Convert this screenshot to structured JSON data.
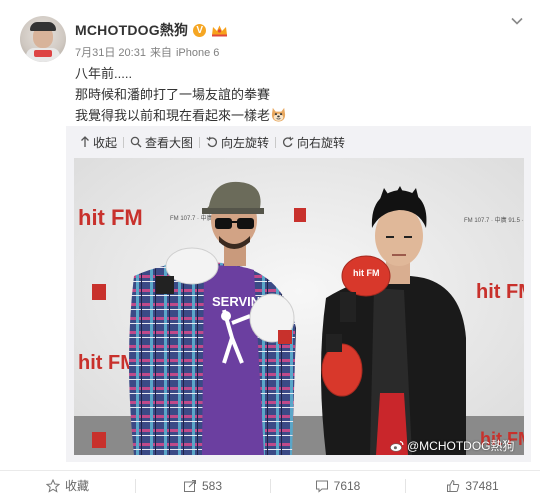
{
  "post": {
    "username": "MCHOTDOG熱狗",
    "verified_badge": "V",
    "time": "7月31日 20:31",
    "source_prefix": "来自",
    "source_device": "iPhone 6",
    "lines": [
      "八年前.....",
      "那時候和潘帥打了一場友誼的拳賽",
      "我覺得我以前和現在看起來一樣老"
    ],
    "emoji_icon": "doge-emoji-icon"
  },
  "toolbar": {
    "collapse": "收起",
    "view_large": "查看大图",
    "rotate_left": "向左旋转",
    "rotate_right": "向右旋转"
  },
  "image": {
    "banner_brand": "hit FM",
    "banner_freq": "FM 107.7 · 中廣 91.5 · 台中 90.5",
    "shirt_text": "SERVIN",
    "glove_text": "hit FM",
    "watermark": "@MCHOTDOG熱狗"
  },
  "footer": {
    "favorite": "收藏",
    "repost_count": "583",
    "comment_count": "7618",
    "like_count": "37481"
  },
  "colors": {
    "accent_orange": "#f5a623",
    "text_main": "#333333",
    "text_meta": "#808080",
    "panel_bg": "#f2f2f5"
  }
}
